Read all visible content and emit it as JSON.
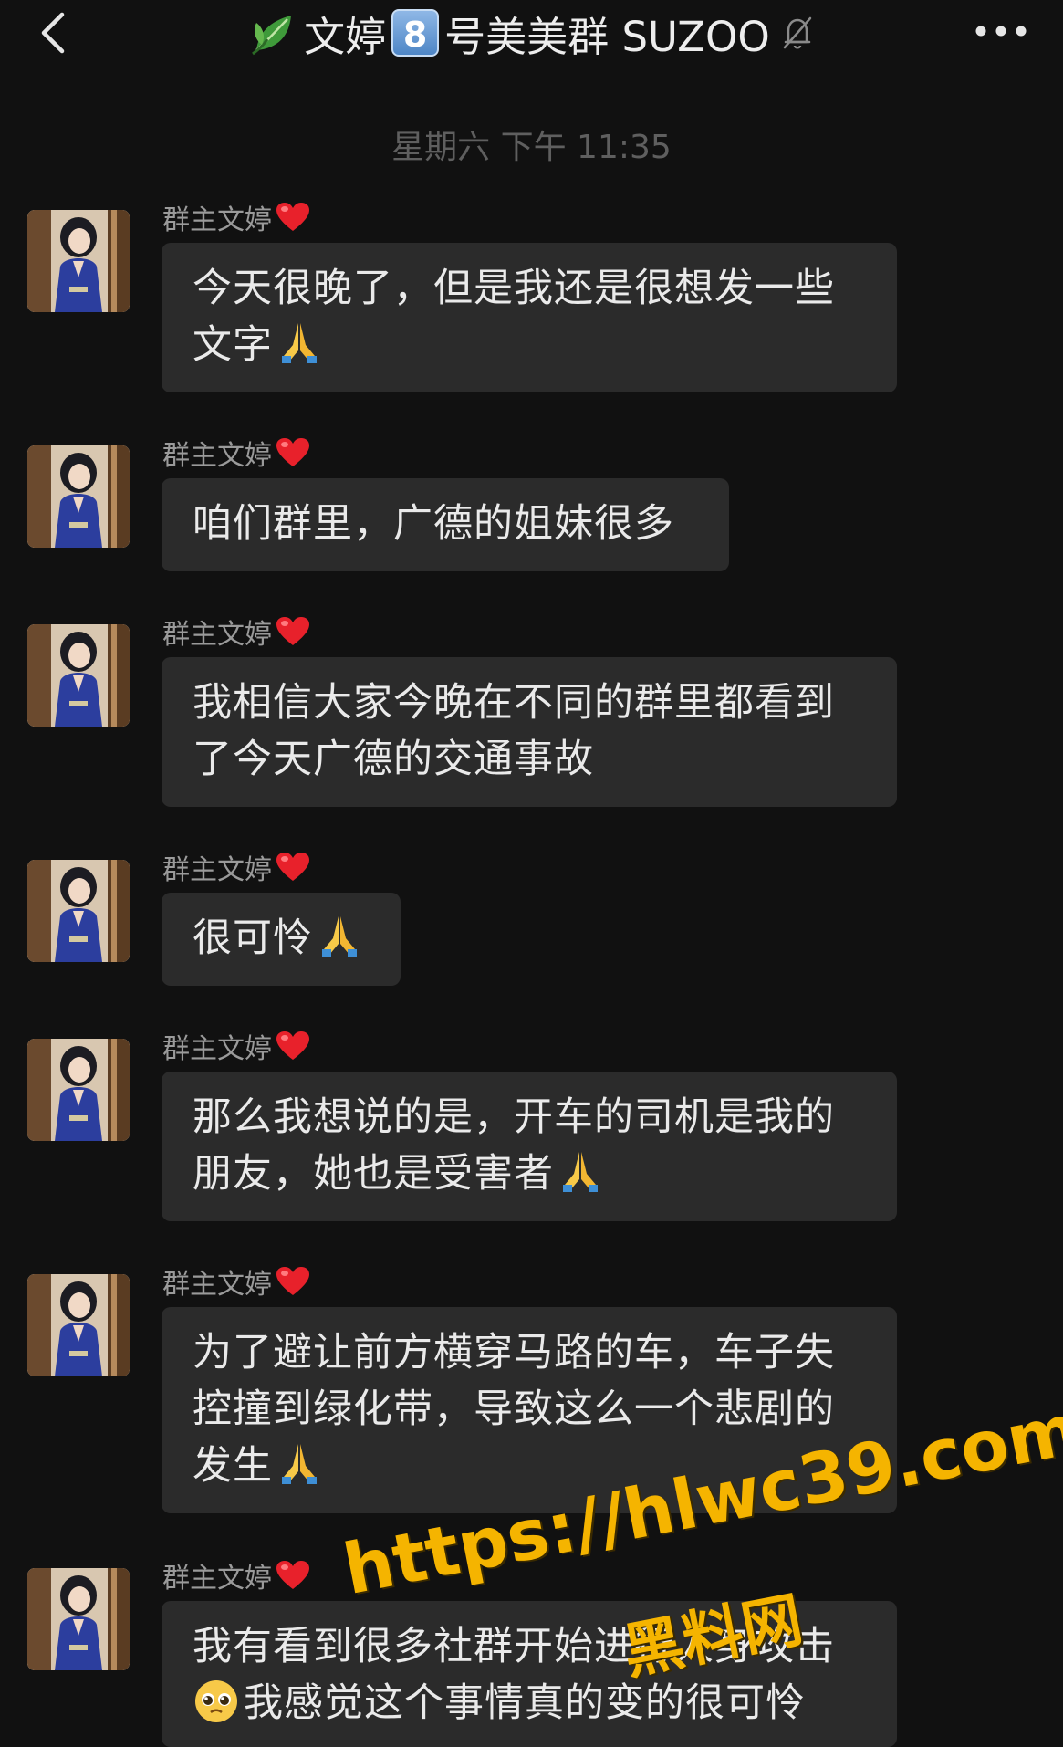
{
  "header": {
    "title_prefix": "文婷",
    "title_badge": "8",
    "title_suffix": "号美美群 SUZOO",
    "back_icon": "chevron-left-icon",
    "more_icon": "more-dots-icon",
    "mute_icon": "bell-off-icon"
  },
  "timestamp": "星期六 下午 11:35",
  "messages": [
    {
      "sender": "群主文婷",
      "lines": [
        "今天很晚了，但是我还是很想发一些",
        "文字"
      ]
    },
    {
      "sender": "群主文婷",
      "lines": [
        "咱们群里，广德的姐妹很多"
      ]
    },
    {
      "sender": "群主文婷",
      "lines": [
        "我相信大家今晚在不同的群里都看到",
        "了今天广德的交通事故"
      ]
    },
    {
      "sender": "群主文婷",
      "lines": [
        "很可怜"
      ]
    },
    {
      "sender": "群主文婷",
      "lines": [
        "那么我想说的是，开车的司机是我的",
        "朋友，她也是受害者"
      ]
    },
    {
      "sender": "群主文婷",
      "lines": [
        "为了避让前方横穿马路的车，车子失",
        "控撞到绿化带，导致这么一个悲剧的",
        "发生"
      ]
    },
    {
      "sender": "群主文婷",
      "lines": [
        "我有看到很多社群开始进行人身攻击",
        "我感觉这个事情真的变的很可怜"
      ]
    }
  ],
  "watermark": {
    "url": "https://hlwc39.com",
    "site": "黑料网"
  },
  "colors": {
    "background": "#111111",
    "bubble": "#2b2b2b",
    "text": "#eaeaea",
    "sender": "#9a9a9a",
    "timestamp": "#5f5f5f",
    "watermark": "#f5b400",
    "heart": "#e8212b"
  }
}
